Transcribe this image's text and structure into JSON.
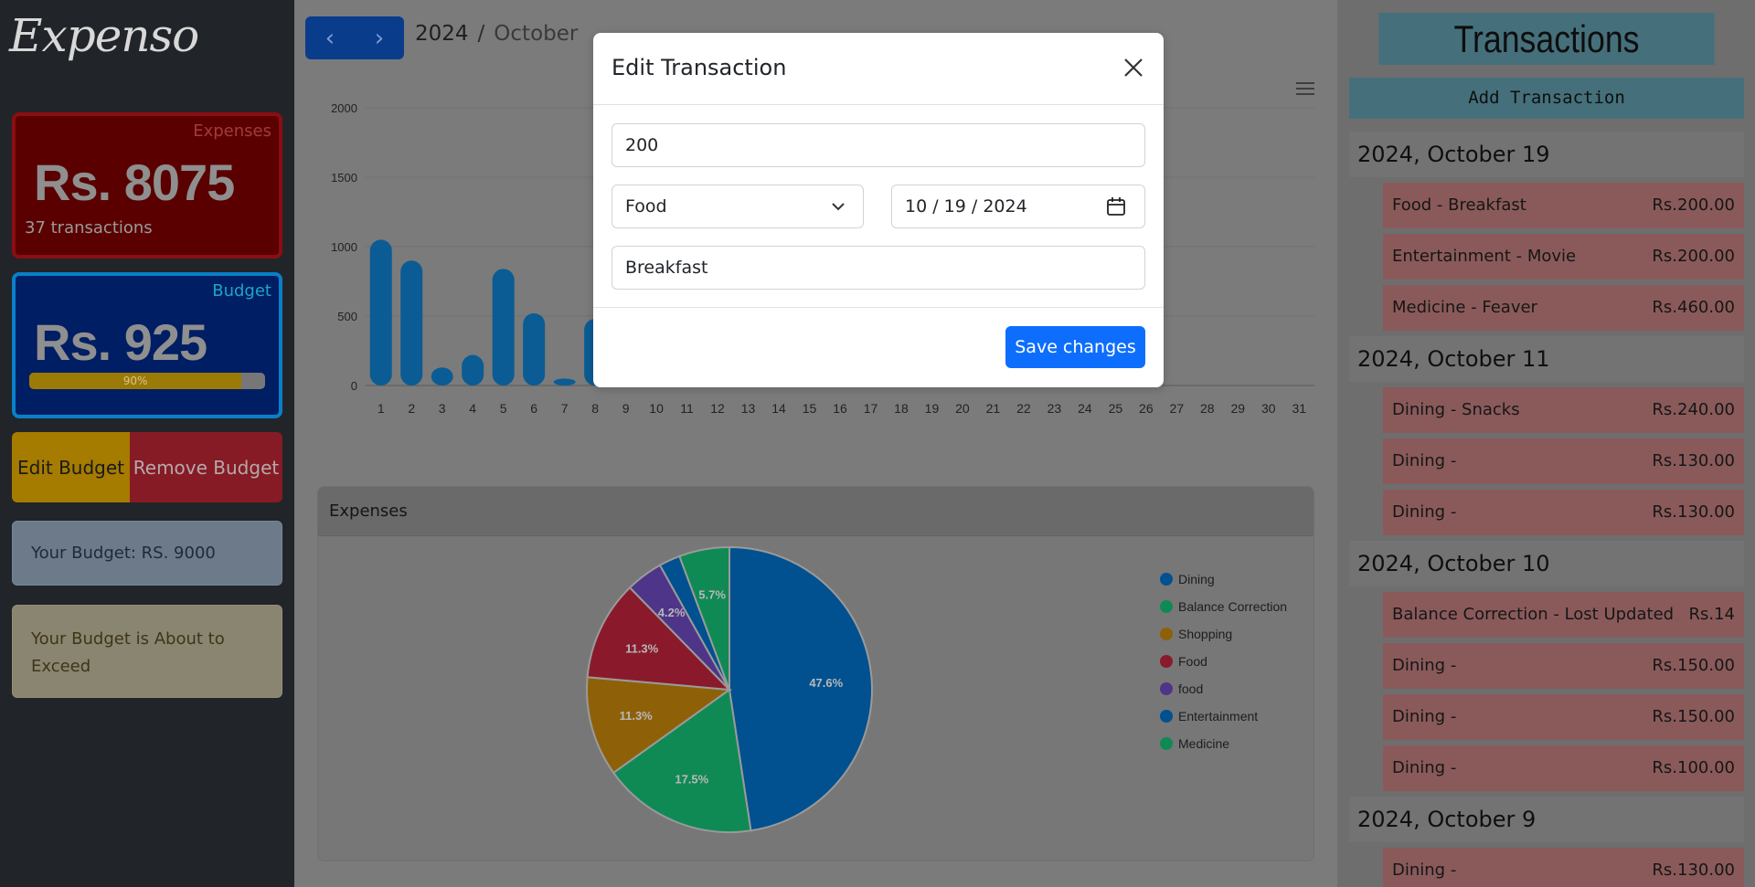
{
  "app": {
    "logo": "Expenso"
  },
  "sidebar": {
    "expenses": {
      "label": "Expenses",
      "amount": "Rs. 8075",
      "count": "37 transactions"
    },
    "budget": {
      "label": "Budget",
      "amount": "Rs. 925",
      "progress_label": "90%",
      "progress_fraction": 0.9
    },
    "edit_budget_label": "Edit Budget",
    "remove_budget_label": "Remove Budget",
    "budget_info": "Your Budget: RS. 9000",
    "budget_warning": "Your Budget is About to Exceed"
  },
  "nav": {
    "prev_icon": "chevron-left-icon",
    "next_icon": "chevron-right-icon",
    "year": "2024",
    "separator": "/",
    "month": "October"
  },
  "bar_chart": {
    "type": "bar",
    "categories": [
      "1",
      "2",
      "3",
      "4",
      "5",
      "6",
      "7",
      "8",
      "9",
      "10",
      "11",
      "12",
      "13",
      "14",
      "15",
      "16",
      "17",
      "18",
      "19",
      "20",
      "21",
      "22",
      "23",
      "24",
      "25",
      "26",
      "27",
      "28",
      "29",
      "30",
      "31"
    ],
    "values": [
      1050,
      900,
      130,
      220,
      840,
      520,
      50,
      480,
      0,
      0,
      0,
      0,
      0,
      0,
      0,
      0,
      0,
      0,
      0,
      0,
      0,
      0,
      0,
      0,
      0,
      0,
      0,
      0,
      0,
      0,
      0
    ],
    "yticks": [
      "0",
      "500",
      "1000",
      "1500",
      "2000"
    ],
    "ylim": [
      0,
      2000
    ],
    "color": "#0b5c94"
  },
  "expenses_panel": {
    "title": "Expenses"
  },
  "chart_data": {
    "type": "pie",
    "slices": [
      {
        "name": "Dining",
        "value": 47.6,
        "label": "47.6%",
        "color": "#01508f"
      },
      {
        "name": "Balance Correction",
        "value": 17.5,
        "label": "17.5%",
        "color": "#0f8a55"
      },
      {
        "name": "Shopping",
        "value": 11.3,
        "label": "11.3%",
        "color": "#8e6109"
      },
      {
        "name": "Food",
        "value": 11.3,
        "label": "11.3%",
        "color": "#8a1a2b"
      },
      {
        "name": "food",
        "value": 4.2,
        "label": "4.2%",
        "color": "#4e3589"
      },
      {
        "name": "Entertainment",
        "value": 2.4,
        "label": "",
        "color": "#01508f"
      },
      {
        "name": "Medicine",
        "value": 5.7,
        "label": "5.7%",
        "color": "#0f8a55"
      }
    ],
    "legend_position": "right"
  },
  "transactions": {
    "title": "Transactions",
    "add_label": "Add Transaction",
    "groups": [
      {
        "date": "2024, October 19",
        "items": [
          {
            "name": "Food - Breakfast",
            "amount": "Rs.200.00"
          },
          {
            "name": "Entertainment - Movie",
            "amount": "Rs.200.00"
          },
          {
            "name": "Medicine - Feaver",
            "amount": "Rs.460.00"
          }
        ]
      },
      {
        "date": "2024, October 11",
        "items": [
          {
            "name": "Dining - Snacks",
            "amount": "Rs.240.00"
          },
          {
            "name": "Dining -",
            "amount": "Rs.130.00"
          },
          {
            "name": "Dining -",
            "amount": "Rs.130.00"
          }
        ]
      },
      {
        "date": "2024, October 10",
        "items": [
          {
            "name": "Balance Correction - Lost Updated",
            "amount": "Rs.14"
          },
          {
            "name": "Dining -",
            "amount": "Rs.150.00"
          },
          {
            "name": "Dining -",
            "amount": "Rs.150.00"
          },
          {
            "name": "Dining -",
            "amount": "Rs.100.00"
          }
        ]
      },
      {
        "date": "2024, October 9",
        "items": [
          {
            "name": "Dining -",
            "amount": "Rs.130.00"
          }
        ]
      }
    ]
  },
  "modal": {
    "title": "Edit Transaction",
    "amount_value": "200",
    "category_value": "Food",
    "date_value": "10 / 19 / 2024",
    "description_value": "Breakfast",
    "save_label": "Save changes",
    "close_icon": "close-icon"
  }
}
